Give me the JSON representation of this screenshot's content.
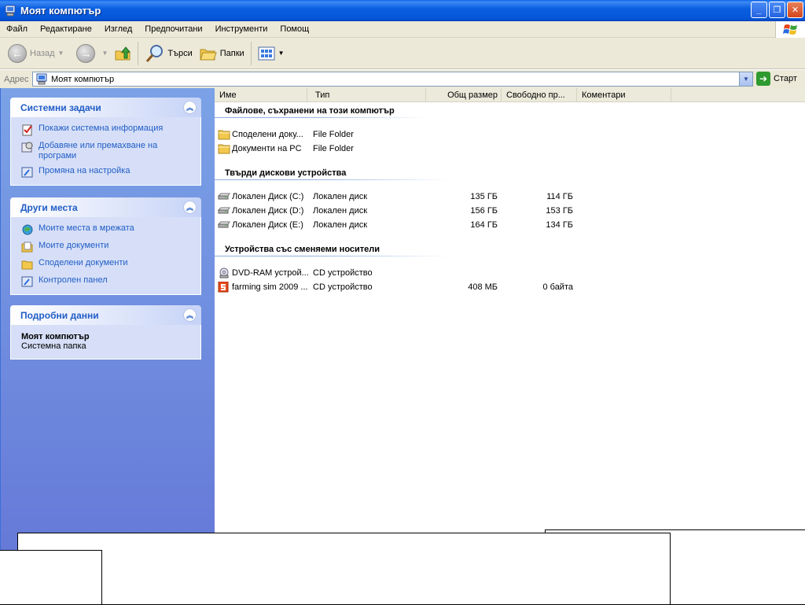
{
  "window": {
    "title": "Моят компютър"
  },
  "menu": [
    "Файл",
    "Редактиране",
    "Изглед",
    "Предпочитани",
    "Инструменти",
    "Помощ"
  ],
  "toolbar": {
    "back": "Назад",
    "search": "Търси",
    "folders": "Папки"
  },
  "address": {
    "label": "Адрес",
    "value": "Моят компютър",
    "go": "Старт"
  },
  "tasks_panel": {
    "title": "Системни задачи",
    "items": [
      "Покажи системна информация",
      "Добавяне или премахване на програми",
      "Промяна на настройка"
    ]
  },
  "places_panel": {
    "title": "Други места",
    "items": [
      "Моите места в мрежата",
      "Моите документи",
      "Споделени документи",
      "Контролен панел"
    ]
  },
  "details_panel": {
    "title": "Подробни данни",
    "name": "Моят компютър",
    "kind": "Системна папка"
  },
  "columns": [
    "Име",
    "Тип",
    "Общ размер",
    "Свободно пр...",
    "Коментари"
  ],
  "groups": {
    "files": {
      "title": "Файлове, съхранени на този компютър",
      "rows": [
        {
          "name": "Споделени доку...",
          "type": "File Folder",
          "total": "",
          "free": ""
        },
        {
          "name": "Документи на PC",
          "type": "File Folder",
          "total": "",
          "free": ""
        }
      ]
    },
    "disks": {
      "title": "Твърди дискови устройства",
      "rows": [
        {
          "name": "Локален Диск (C:)",
          "type": "Локален диск",
          "total": "135 ГБ",
          "free": "114 ГБ"
        },
        {
          "name": "Локален Диск (D:)",
          "type": "Локален диск",
          "total": "156 ГБ",
          "free": "153 ГБ"
        },
        {
          "name": "Локален Диск (E:)",
          "type": "Локален диск",
          "total": "164 ГБ",
          "free": "134 ГБ"
        }
      ]
    },
    "removable": {
      "title": "Устройства със сменяеми носители",
      "rows": [
        {
          "name": "DVD-RAM устрой...",
          "type": "CD устройство",
          "total": "",
          "free": ""
        },
        {
          "name": "farming sim 2009 ...",
          "type": "CD устройство",
          "total": "408 МБ",
          "free": "0 байта"
        }
      ]
    }
  }
}
